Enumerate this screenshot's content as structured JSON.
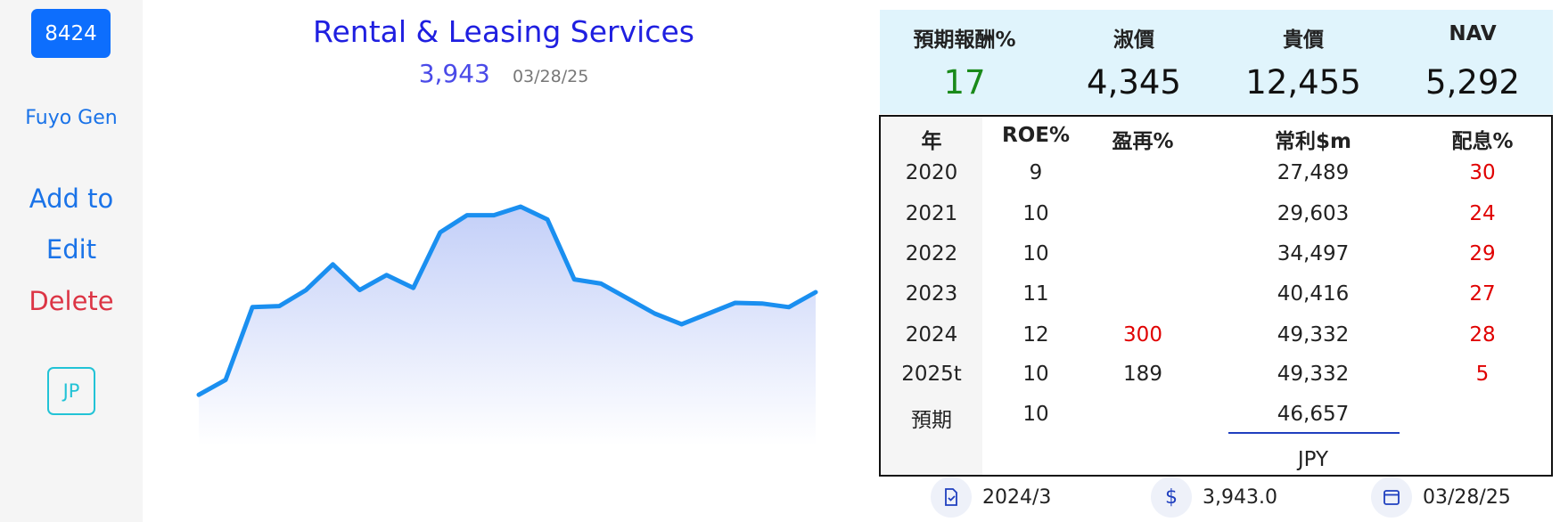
{
  "sidebar": {
    "ticker": "8424",
    "company": "Fuyo Gen",
    "add_label": "Add to",
    "edit_label": "Edit",
    "delete_label": "Delete",
    "market_label": "JP"
  },
  "header": {
    "title": "Rental & Leasing Services",
    "price": "3,943",
    "date": "03/28/25"
  },
  "chart_data": {
    "type": "area",
    "color": "#1a8ff0",
    "fill_top": "#c7d2f8",
    "values": [
      3120,
      3190,
      3530,
      3535,
      3610,
      3730,
      3610,
      3680,
      3620,
      3880,
      3960,
      3960,
      4000,
      3940,
      3660,
      3640,
      3570,
      3500,
      3450,
      3500,
      3550,
      3547,
      3530,
      3600
    ]
  },
  "stats": [
    {
      "label": "預期報酬%",
      "value": "17",
      "highlight": "green"
    },
    {
      "label": "淑價",
      "value": "4,345"
    },
    {
      "label": "貴價",
      "value": "12,455"
    },
    {
      "label": "NAV",
      "value": "5,292"
    }
  ],
  "table": {
    "headers": [
      "年",
      "ROE%",
      "盈再%",
      "常利$m",
      "配息%"
    ],
    "rows": [
      {
        "year": "2020",
        "roe": "9",
        "reinvest": "",
        "profit": "27,489",
        "div": "30"
      },
      {
        "year": "2021",
        "roe": "10",
        "reinvest": "",
        "profit": "29,603",
        "div": "24"
      },
      {
        "year": "2022",
        "roe": "10",
        "reinvest": "",
        "profit": "34,497",
        "div": "29"
      },
      {
        "year": "2023",
        "roe": "11",
        "reinvest": "",
        "profit": "40,416",
        "div": "27"
      },
      {
        "year": "2024",
        "roe": "12",
        "reinvest": "300",
        "profit": "49,332",
        "div": "28"
      },
      {
        "year": "2025t",
        "roe": "10",
        "reinvest": "189",
        "profit": "49,332",
        "div": "5"
      },
      {
        "year": "預期",
        "roe": "10",
        "reinvest": "",
        "profit": "46,657",
        "div": ""
      }
    ],
    "currency": "JPY"
  },
  "footer": {
    "report_period": "2024/3",
    "price": "3,943.0",
    "date": "03/28/25"
  }
}
